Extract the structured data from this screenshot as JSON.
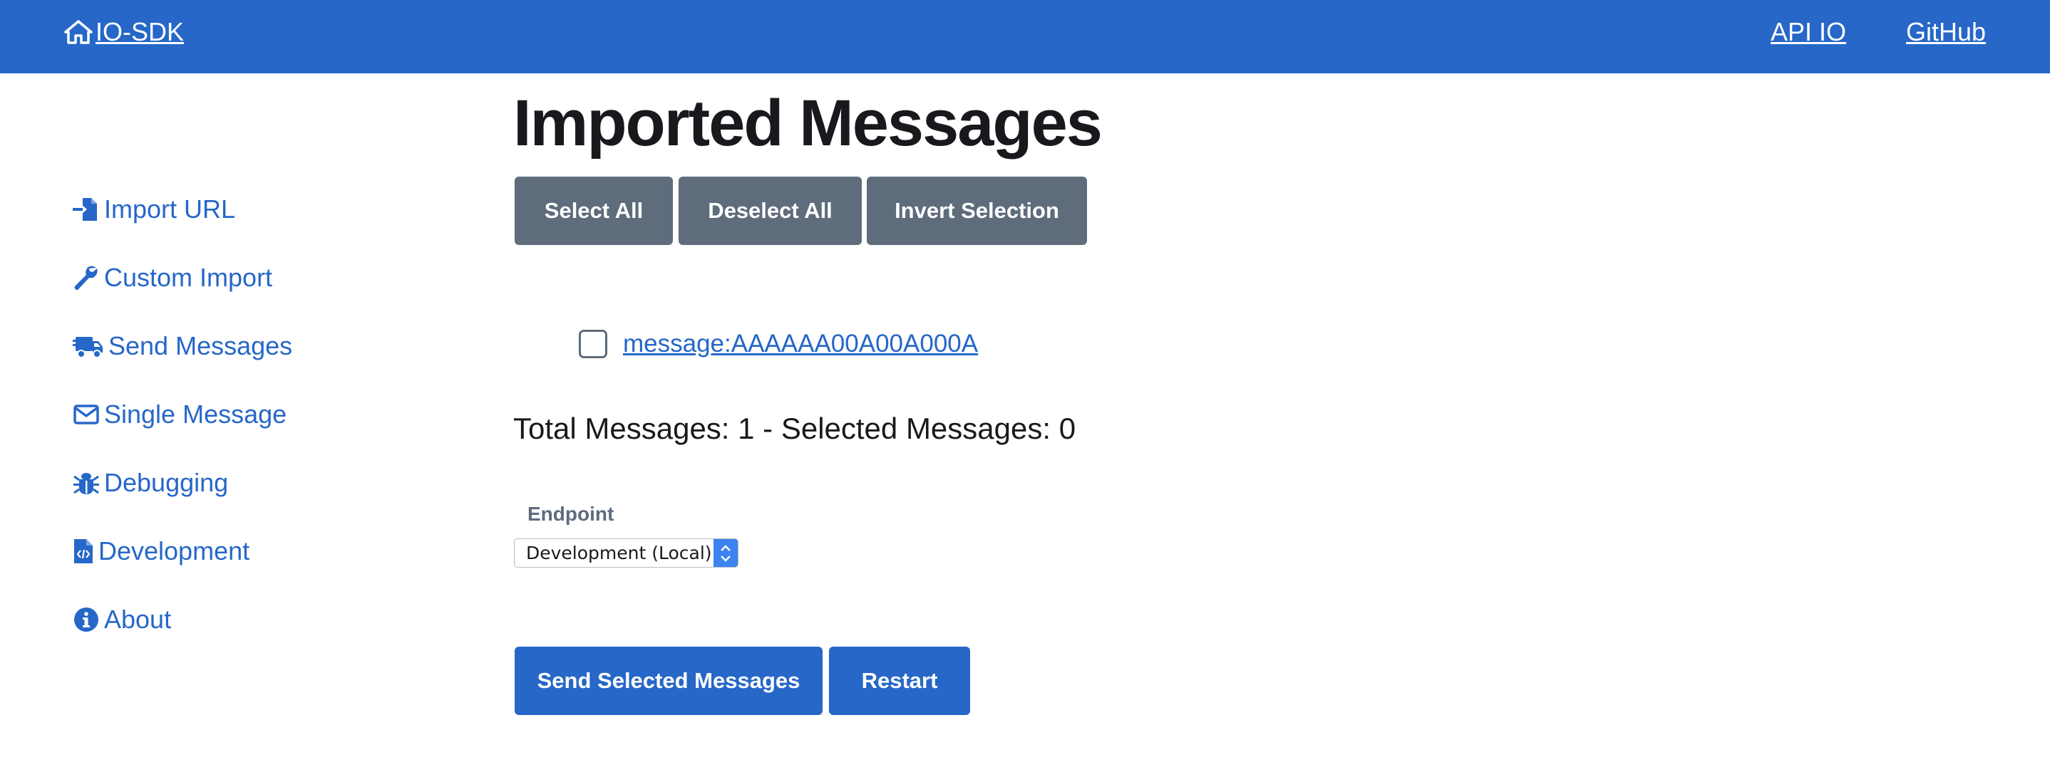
{
  "navbar": {
    "brand": "IO-SDK",
    "links": [
      "API IO",
      "GitHub"
    ]
  },
  "sidebar": {
    "items": [
      {
        "label": "Import URL",
        "icon": "import-icon"
      },
      {
        "label": "Custom Import",
        "icon": "wrench-icon"
      },
      {
        "label": "Send Messages",
        "icon": "truck-icon"
      },
      {
        "label": "Single Message",
        "icon": "envelope-icon"
      },
      {
        "label": "Debugging",
        "icon": "bug-icon"
      },
      {
        "label": "Development",
        "icon": "code-file-icon"
      },
      {
        "label": "About",
        "icon": "info-icon"
      }
    ]
  },
  "main": {
    "title": "Imported Messages",
    "selection_buttons": [
      "Select All",
      "Deselect All",
      "Invert Selection"
    ],
    "messages": [
      {
        "label": "message:AAAAAA00A00A000A",
        "checked": false
      }
    ],
    "totals": "Total Messages: 1 - Selected Messages: 0",
    "endpoint": {
      "label": "Endpoint",
      "selected": "Development (Local)"
    },
    "actions": [
      "Send Selected Messages",
      "Restart"
    ]
  },
  "colors": {
    "primary": "#2667c8",
    "secondary": "#5e6c7c",
    "text": "#17191c"
  }
}
